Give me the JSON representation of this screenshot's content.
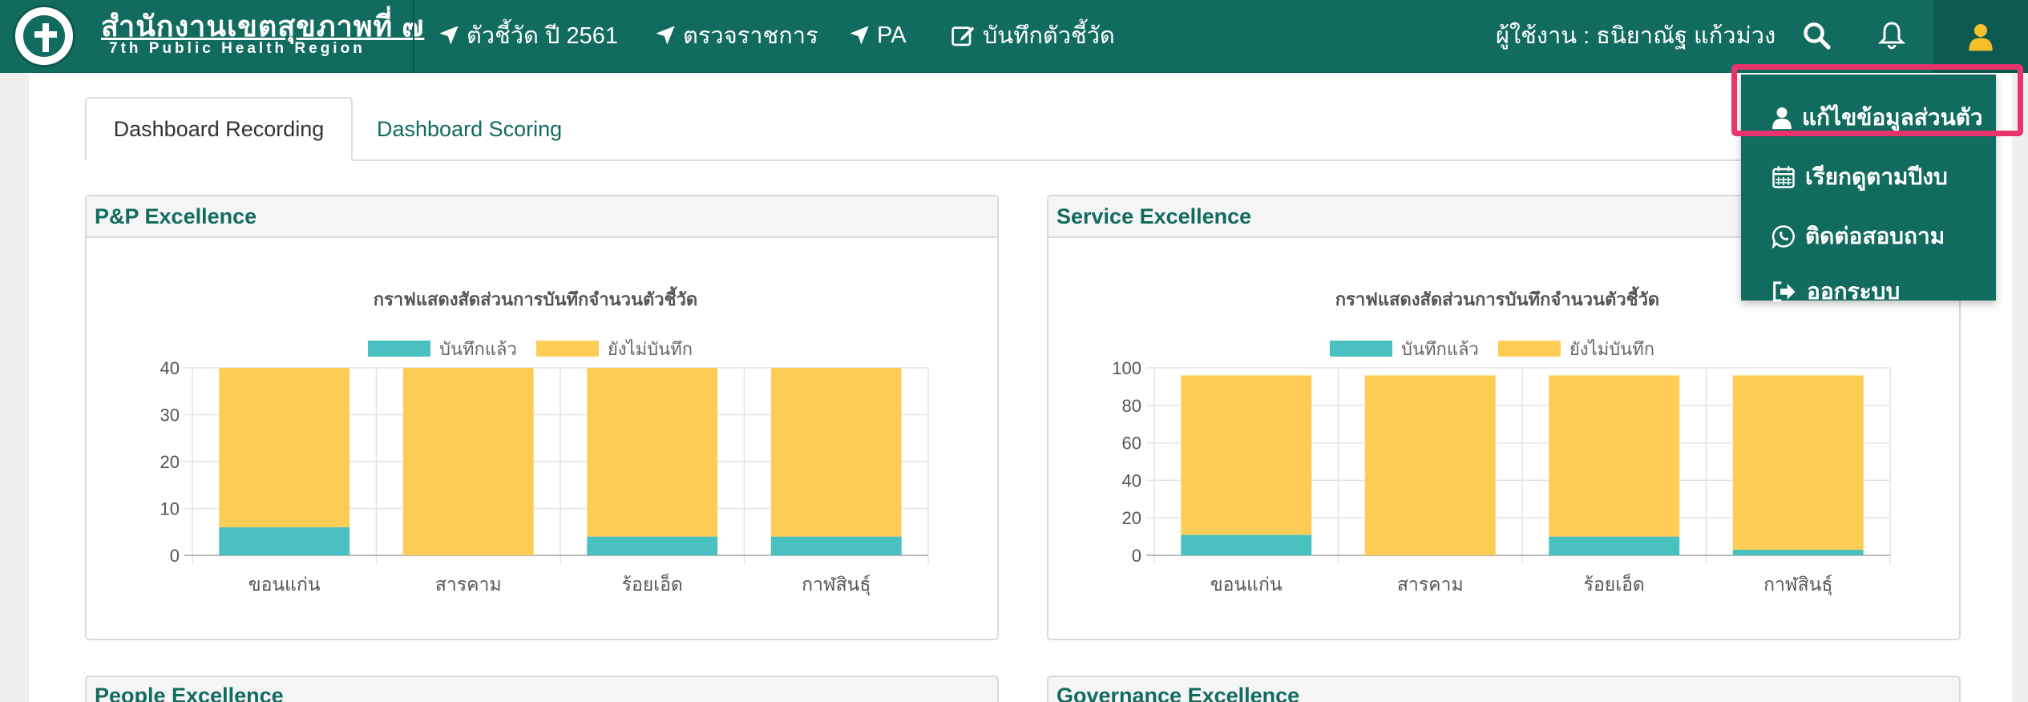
{
  "brand": {
    "title": "สำนักงานเขตสุขภาพที่ ๗",
    "subtitle": "7th Public Health Region"
  },
  "nav": {
    "items": [
      {
        "label": "ตัวชี้วัด ปี 2561",
        "icon": "location-arrow-icon"
      },
      {
        "label": "ตรวจราชการ",
        "icon": "location-arrow-icon"
      },
      {
        "label": "PA",
        "icon": "location-arrow-icon"
      },
      {
        "label": "บันทึกตัวชี้วัด",
        "icon": "edit-icon"
      }
    ],
    "user_label": "ผู้ใช้งาน : ธนิยาณัฐ แก้วม่วง",
    "accent_color": "#116b5e",
    "user_icon_color": "#f6c02c"
  },
  "tabs": [
    {
      "label": "Dashboard Recording",
      "active": true
    },
    {
      "label": "Dashboard Scoring",
      "active": false
    }
  ],
  "panels": {
    "pp": "P&P Excellence",
    "service": "Service Excellence",
    "people": "People Excellence",
    "governance": "Governance Excellence"
  },
  "dropdown": {
    "items": [
      {
        "label": "แก้ไขข้อมูลส่วนตัว",
        "icon": "user-icon"
      },
      {
        "label": "เรียกดูตามปีงบ",
        "icon": "calendar-icon"
      },
      {
        "label": "ติดต่อสอบถาม",
        "icon": "whatsapp-icon"
      },
      {
        "label": "ออกระบบ",
        "icon": "sign-out-icon"
      }
    ],
    "highlight_color": "#e8336d"
  },
  "chart_data": [
    {
      "type": "bar",
      "stacked": true,
      "title": "กราฟแสดงสัดส่วนการบันทึกจำนวนตัวชี้วัด",
      "categories": [
        "ขอนแก่น",
        "สารคาม",
        "ร้อยเอ็ด",
        "กาฬสินธุ์"
      ],
      "series": [
        {
          "name": "บันทึกแล้ว",
          "color": "#4bc0c0",
          "values": [
            6,
            0,
            4,
            4
          ]
        },
        {
          "name": "ยังไม่บันทึก",
          "color": "#ffcd56",
          "values": [
            34,
            40,
            36,
            36
          ]
        }
      ],
      "ylim": [
        0,
        40
      ],
      "yticks": [
        0,
        10,
        20,
        30,
        40
      ],
      "legend": "top",
      "grid": true
    },
    {
      "type": "bar",
      "stacked": true,
      "title": "กราฟแสดงสัดส่วนการบันทึกจำนวนตัวชี้วัด",
      "categories": [
        "ขอนแก่น",
        "สารคาม",
        "ร้อยเอ็ด",
        "กาฬสินธุ์"
      ],
      "series": [
        {
          "name": "บันทึกแล้ว",
          "color": "#4bc0c0",
          "values": [
            11,
            0,
            10,
            3
          ]
        },
        {
          "name": "ยังไม่บันทึก",
          "color": "#ffcd56",
          "values": [
            85,
            96,
            86,
            93
          ]
        }
      ],
      "ylim": [
        0,
        100
      ],
      "yticks": [
        0,
        20,
        40,
        60,
        80,
        100
      ],
      "legend": "top",
      "grid": true
    }
  ]
}
